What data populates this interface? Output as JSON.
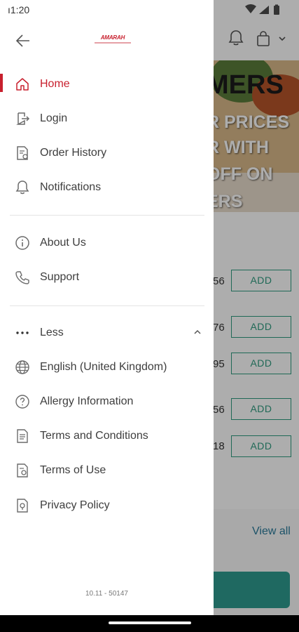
{
  "status_bar": {
    "time": "ı1:20"
  },
  "background": {
    "banner_lines": [
      "MERS",
      "R PRICES",
      "R WITH",
      "OFF ON",
      "ERS"
    ],
    "prices": [
      "56",
      "76",
      "95",
      "56",
      "18"
    ],
    "add_label": "ADD",
    "view_all": "View all"
  },
  "drawer": {
    "brand": "AMARAH",
    "primary_items": [
      {
        "label": "Home",
        "icon": "home-icon",
        "active": true
      },
      {
        "label": "Login",
        "icon": "login-icon"
      },
      {
        "label": "Order History",
        "icon": "receipt-icon"
      },
      {
        "label": "Notifications",
        "icon": "bell-icon"
      }
    ],
    "secondary_items": [
      {
        "label": "About Us",
        "icon": "info-icon"
      },
      {
        "label": "Support",
        "icon": "phone-icon"
      }
    ],
    "more_toggle": {
      "label": "Less",
      "icon": "more-dots-icon"
    },
    "extra_items": [
      {
        "label": "English (United Kingdom)",
        "icon": "globe-icon"
      },
      {
        "label": "Allergy Information",
        "icon": "question-icon"
      },
      {
        "label": "Terms and Conditions",
        "icon": "document-icon"
      },
      {
        "label": "Terms of Use",
        "icon": "document-settings-icon"
      },
      {
        "label": "Privacy Policy",
        "icon": "privacy-icon"
      }
    ],
    "version": "10.11 - 50147"
  },
  "colors": {
    "accent": "#c8202e",
    "teal": "#2e9b7f",
    "text": "#3e3e3e",
    "icon": "#6b6b6b"
  }
}
